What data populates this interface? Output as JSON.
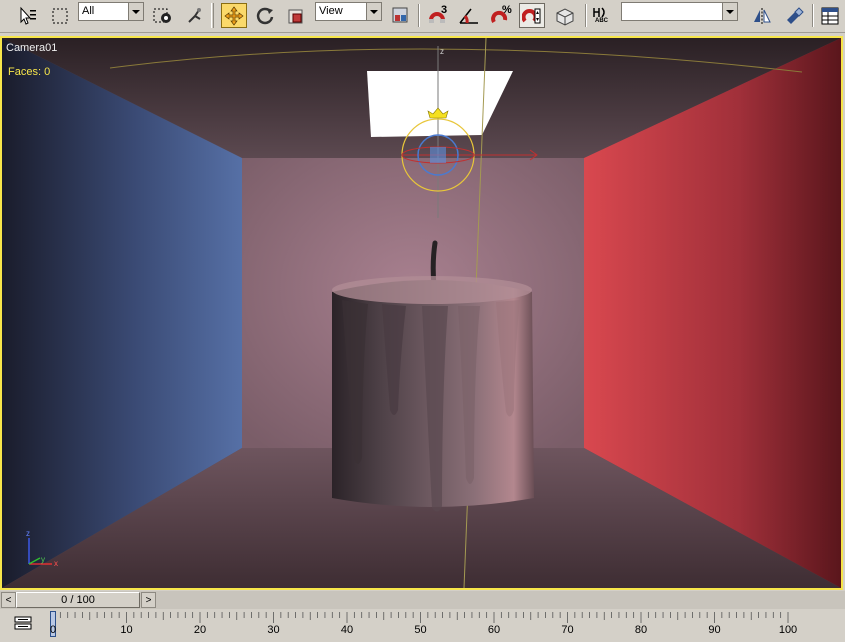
{
  "toolbar": {
    "selection_filter": {
      "value": "All"
    },
    "reference_coord": {
      "value": "View"
    },
    "snaps_superscript": "3",
    "percent_snap_label": "%",
    "named_selection": {
      "value": ""
    },
    "abc_label": "ABC"
  },
  "viewport": {
    "name": "Camera01",
    "faces": "Faces: 0",
    "axis_labels": {
      "x": "x",
      "y": "y",
      "z": "z"
    },
    "gizmo_z": "z",
    "colors": {
      "left_wall": "#4d6499",
      "right_wall": "#c9424b",
      "back_wall": "#94707f",
      "candle": "#6e5a60",
      "active_border": "#f7e64a"
    }
  },
  "timeslider": {
    "frame_display": "0 / 100",
    "prev_symbol": "<",
    "next_symbol": ">"
  },
  "trackbar": {
    "ticks": [
      "0",
      "10",
      "20",
      "30",
      "40",
      "50",
      "60",
      "70",
      "80",
      "90",
      "100"
    ]
  }
}
